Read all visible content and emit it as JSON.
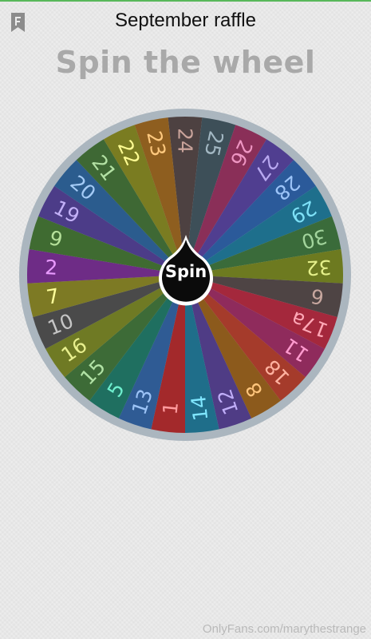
{
  "app_bar": {
    "title": "September raffle",
    "bookmark_icon": "bookmark-f-icon"
  },
  "heading": "Spin the wheel",
  "spin_label": "Spin",
  "watermark": "OnlyFans.com/marythestrange",
  "wheel": {
    "segments": [
      {
        "label": "24",
        "color": "#4d4141",
        "text_color": "#c9a39a"
      },
      {
        "label": "25",
        "color": "#3d4f58",
        "text_color": "#a2b7c2"
      },
      {
        "label": "26",
        "color": "#8a2f58",
        "text_color": "#ee95c2"
      },
      {
        "label": "27",
        "color": "#503e90",
        "text_color": "#b8a8f0"
      },
      {
        "label": "28",
        "color": "#2b5a9a",
        "text_color": "#9cc4f8"
      },
      {
        "label": "29",
        "color": "#1e6f8c",
        "text_color": "#7ee1f7"
      },
      {
        "label": "30",
        "color": "#3a6b3a",
        "text_color": "#a2d49c"
      },
      {
        "label": "32",
        "color": "#6d7a20",
        "text_color": "#e5f08a"
      },
      {
        "label": "6",
        "color": "#4e4444",
        "text_color": "#c7a79f"
      },
      {
        "label": "17a",
        "color": "#a4283c",
        "text_color": "#ffa8b6"
      },
      {
        "label": "11",
        "color": "#8f2b5c",
        "text_color": "#ff9bcf"
      },
      {
        "label": "18",
        "color": "#a53b2b",
        "text_color": "#ffb2a0"
      },
      {
        "label": "8",
        "color": "#8c5a1c",
        "text_color": "#ffc57c"
      },
      {
        "label": "12",
        "color": "#4f3c85",
        "text_color": "#c0aef8"
      },
      {
        "label": "14",
        "color": "#1f6e8a",
        "text_color": "#80e7ff"
      },
      {
        "label": "1",
        "color": "#a3292b",
        "text_color": "#ff9b9e"
      },
      {
        "label": "13",
        "color": "#2f5b94",
        "text_color": "#9cc3f6"
      },
      {
        "label": "5",
        "color": "#1f6f60",
        "text_color": "#6ff0cf"
      },
      {
        "label": "15",
        "color": "#3d6b37",
        "text_color": "#b1e2a5"
      },
      {
        "label": "16",
        "color": "#6f7a24",
        "text_color": "#e8ef8e"
      },
      {
        "label": "10",
        "color": "#4a4a4a",
        "text_color": "#c5c5c5"
      },
      {
        "label": "7",
        "color": "#7d7a24",
        "text_color": "#ffff9a"
      },
      {
        "label": "2",
        "color": "#6e2c86",
        "text_color": "#e99aff"
      },
      {
        "label": "9",
        "color": "#3f6b31",
        "text_color": "#b6e19b"
      },
      {
        "label": "19",
        "color": "#4c3c88",
        "text_color": "#c2b0f7"
      },
      {
        "label": "20",
        "color": "#2b5c8e",
        "text_color": "#a4cbf6"
      },
      {
        "label": "21",
        "color": "#3e6834",
        "text_color": "#b3e1a4"
      },
      {
        "label": "22",
        "color": "#7a7c21",
        "text_color": "#fdfb92"
      },
      {
        "label": "23",
        "color": "#8e5e1f",
        "text_color": "#ffc97e"
      }
    ]
  }
}
